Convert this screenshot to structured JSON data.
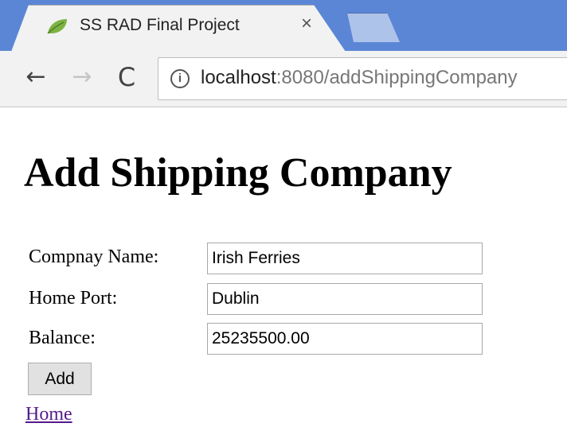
{
  "browser": {
    "tab": {
      "title": "SS RAD Final Project",
      "close_glyph": "×",
      "favicon": "leaf-icon"
    },
    "nav": {
      "back_glyph": "←",
      "forward_glyph": "→",
      "reload_glyph": "C"
    },
    "address": {
      "info_glyph": "i",
      "host": "localhost",
      "rest": ":8080/addShippingCompany"
    }
  },
  "page": {
    "title": "Add Shipping Company",
    "form": {
      "fields": [
        {
          "label": "Compnay Name:",
          "value": "Irish Ferries"
        },
        {
          "label": "Home Port:",
          "value": "Dublin"
        },
        {
          "label": "Balance:",
          "value": "25235500.00"
        }
      ],
      "submit_label": "Add"
    },
    "home_link": "Home"
  },
  "colors": {
    "tabstrip": "#5b86d6",
    "link_visited": "#551a8b",
    "favicon_green": "#7cb342"
  }
}
